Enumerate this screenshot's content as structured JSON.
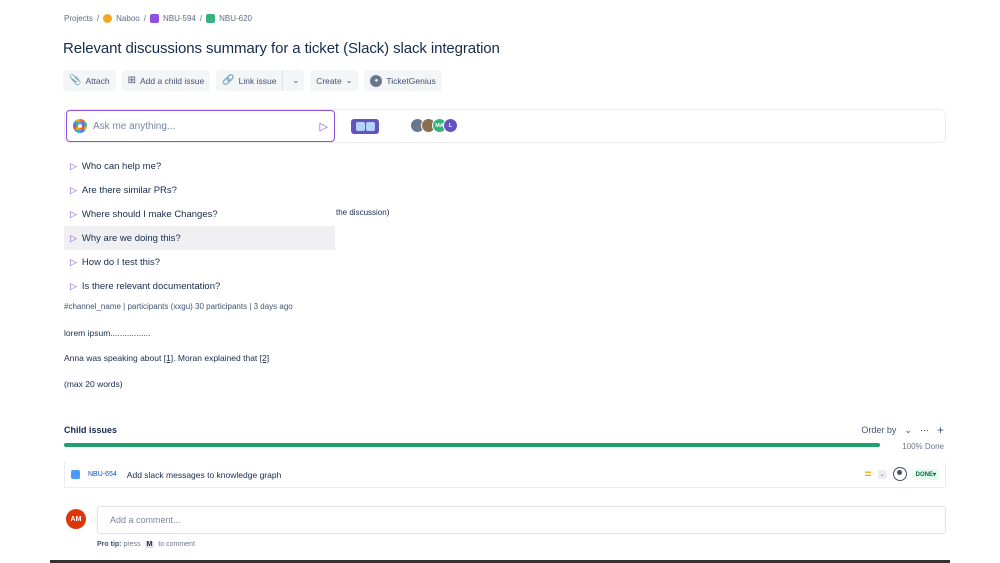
{
  "breadcrumb": {
    "items": [
      "Projects",
      "Naboo",
      "NBU-594",
      "NBU-620"
    ],
    "separator": "/"
  },
  "title": "Relevant discussions summary for a ticket (Slack) slack integration",
  "toolbar": {
    "attach": "Attach",
    "add_child": "Add a child issue",
    "link_issue": "Link issue",
    "create": "Create",
    "ticketgenius": "TicketGenius"
  },
  "ai": {
    "placeholder": "Ask me anything...",
    "avatars": [
      {
        "initials": "",
        "color": "#6b778c"
      },
      {
        "initials": "",
        "color": "#8c6d4f"
      },
      {
        "initials": "MA",
        "color": "#36b37e"
      },
      {
        "initials": "L",
        "color": "#6554c0"
      }
    ],
    "suggestions": [
      "Who can help me?",
      "Are there similar PRs?",
      "Where should I make Changes?",
      "Why are we doing this?",
      "How do I test this?",
      "Is there relevant documentation?"
    ]
  },
  "description": {
    "behind_text": "the discussion)",
    "cut_line": "#channel_name | participants (xxgu) 30 participants | 3 days ago",
    "line1": "lorem ipsum.................",
    "line2_parts": [
      "Anna was speaking about ",
      "[1]",
      ". Moran explained that ",
      "[2]"
    ],
    "line3": "(max 20 words)"
  },
  "child_issues": {
    "title": "Child issues",
    "order_by": "Order by",
    "progress_percent": 100,
    "progress_label": "100% Done",
    "issues": [
      {
        "key": "NBU-654",
        "summary": "Add slack messages to knowledge graph",
        "status": "DONE"
      }
    ]
  },
  "comment": {
    "avatar_initials": "AM",
    "placeholder": "Add a comment...",
    "protip_label": "Pro tip:",
    "protip_press": "press",
    "protip_key": "M",
    "protip_rest": "to comment"
  },
  "colors": {
    "accent_purple": "#8f4fe0",
    "progress_green": "#22a06b",
    "avatar_red": "#de350b"
  }
}
